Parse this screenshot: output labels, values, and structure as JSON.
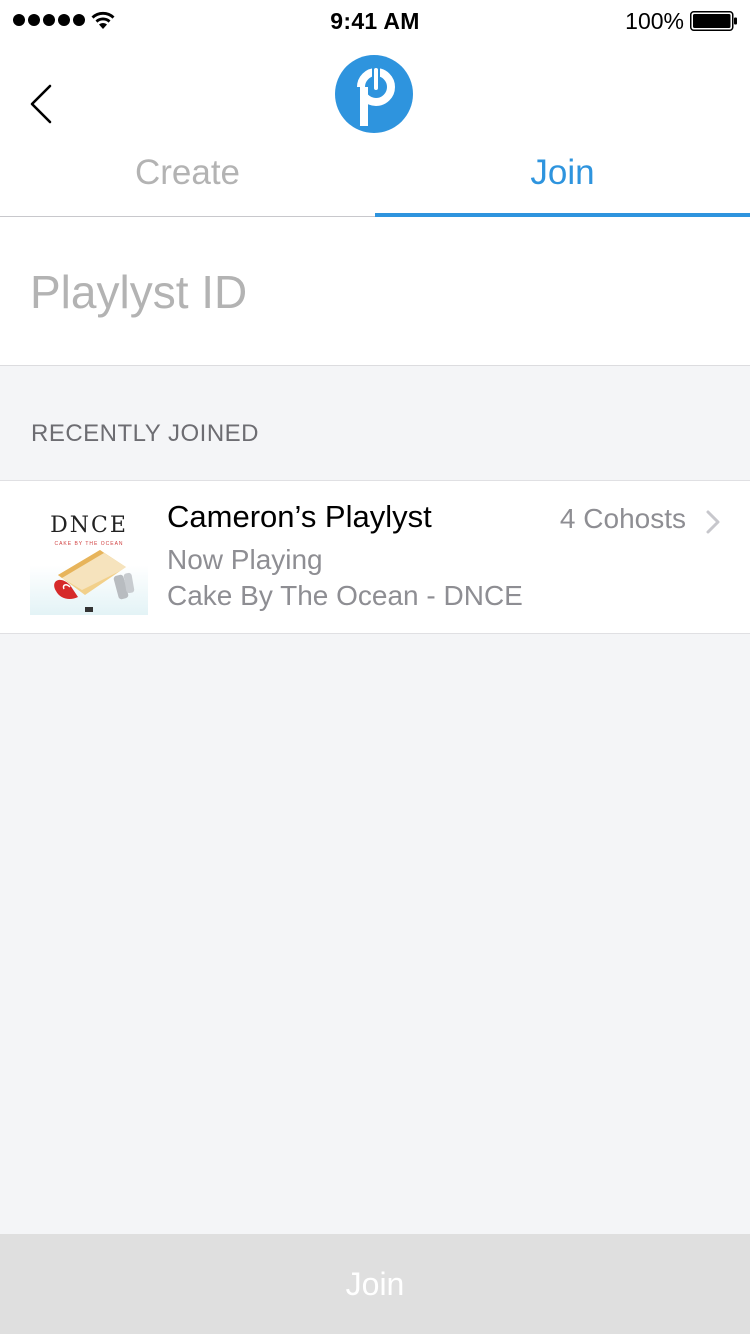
{
  "status_bar": {
    "time": "9:41 AM",
    "battery_percent": "100%",
    "signal_bars": 5,
    "icons": [
      "signal-dots-icon",
      "wifi-icon",
      "battery-icon"
    ]
  },
  "header": {
    "back_icon": "chevron-left-icon",
    "logo_icon": "playlyst-logo-icon",
    "tabs": [
      {
        "label": "Create",
        "active": false
      },
      {
        "label": "Join",
        "active": true
      }
    ]
  },
  "id_input": {
    "placeholder": "Playlyst ID",
    "value": ""
  },
  "recently_joined": {
    "header": "RECENTLY JOINED",
    "items": [
      {
        "title": "Cameron’s Playlyst",
        "cohosts": "4 Cohosts",
        "now_playing_label": "Now Playing",
        "song": "Cake By The Ocean - DNCE",
        "art_text": "DNCE",
        "art_subtext": "CAKE BY THE OCEAN"
      }
    ]
  },
  "footer": {
    "join_label": "Join"
  },
  "colors": {
    "accent": "#2e94de",
    "inactive_tab": "#b3b3b3",
    "background": "#f4f5f7",
    "disabled_button": "#dfdfdf"
  }
}
